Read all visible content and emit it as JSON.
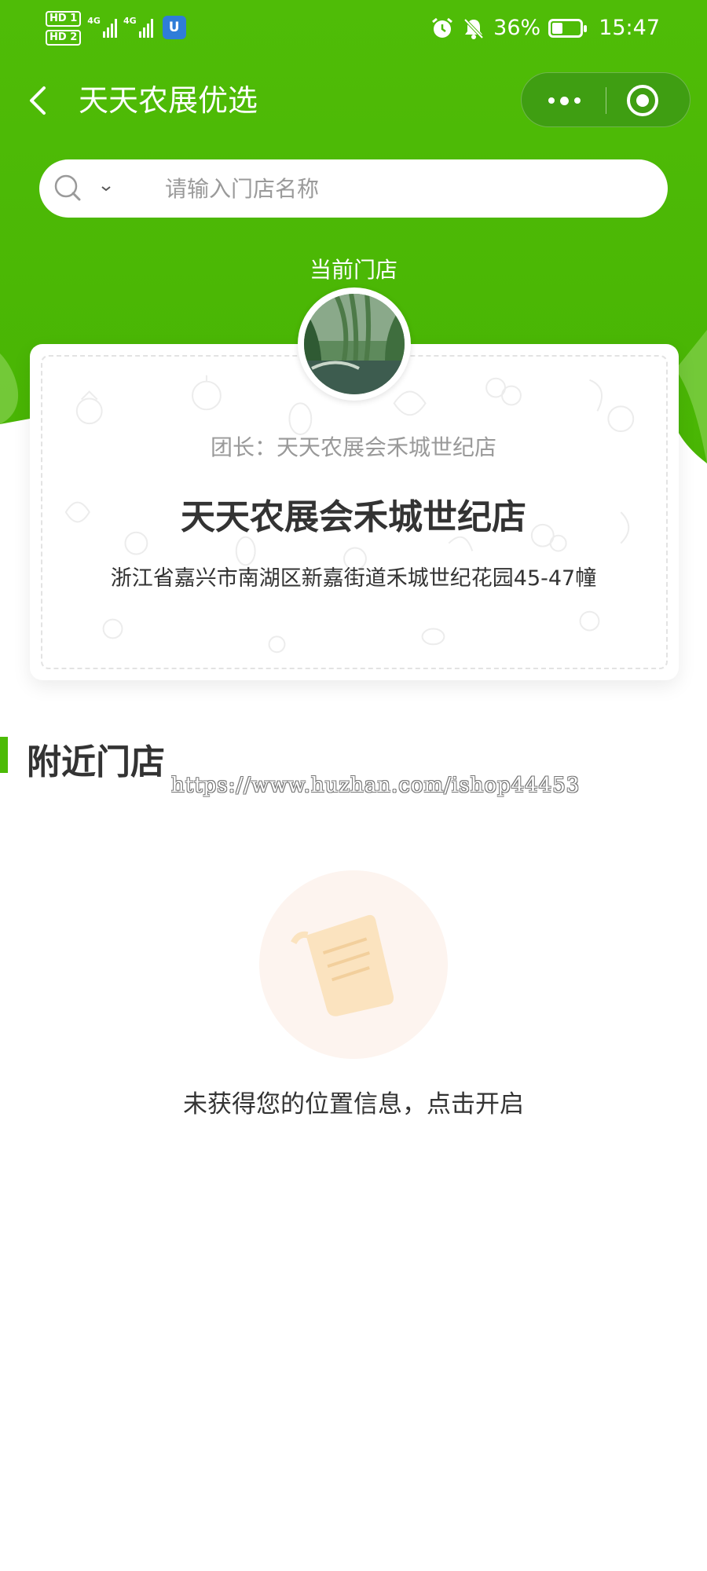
{
  "status_bar": {
    "sim1_label": "HD 1",
    "sim2_label": "HD 2",
    "network1": "4G",
    "network2": "4G",
    "app_badge_icon": "U",
    "battery_percent": "36%",
    "battery_level": 0.36,
    "time": "15:47",
    "icons": [
      "alarm-icon",
      "mute-bell-icon",
      "battery-icon"
    ]
  },
  "nav": {
    "back_icon": "chevron-left-icon",
    "title": "天天农展优选",
    "capsule": {
      "more_icon": "more-dots-icon",
      "close_icon": "target-circle-icon"
    }
  },
  "search": {
    "icon": "search-icon",
    "dropdown_icon": "chevron-down-icon",
    "placeholder": "请输入门店名称",
    "value": ""
  },
  "current_store": {
    "section_label": "当前门店",
    "leader": "团长：天天农展会禾城世纪店",
    "name": "天天农展会禾城世纪店",
    "address": "浙江省嘉兴市南湖区新嘉街道禾城世纪花园45-47幢"
  },
  "nearby": {
    "title": "附近门店",
    "watermark": "https://www.huzhan.com/ishop44453",
    "empty_icon": "document-paper-icon",
    "empty_message": "未获得您的位置信息，点击开启"
  },
  "colors": {
    "brand_green": "#4cbb06",
    "capsule_green": "#3f9e12",
    "text_dark": "#333333",
    "text_gray": "#999999"
  }
}
